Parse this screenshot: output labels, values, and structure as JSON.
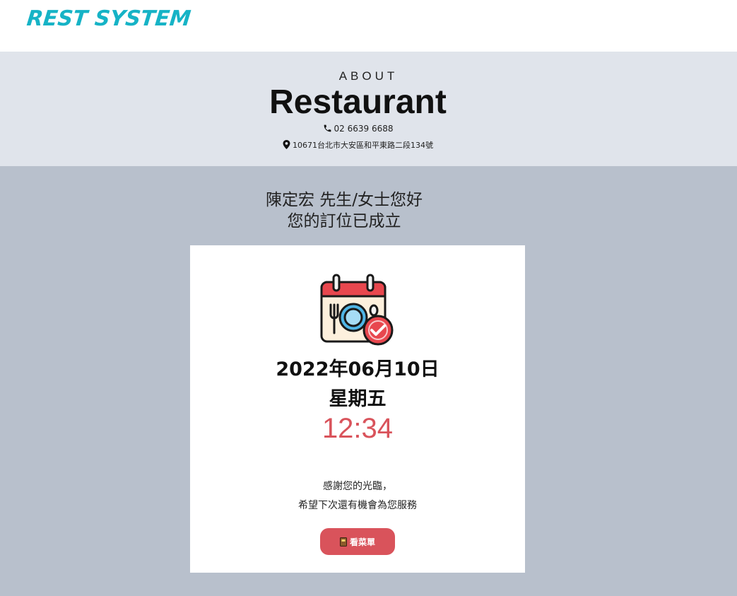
{
  "header": {
    "brand": "REST SYSTEM"
  },
  "hero": {
    "eyebrow": "ABOUT",
    "title": "Restaurant",
    "phone": "02 6639 6688",
    "address": "10671台北市大安區和平東路二段134號"
  },
  "greeting": {
    "line1": "陳定宏 先生/女士您好",
    "line2": "您的訂位已成立"
  },
  "reservation": {
    "date": "2022年06月10日",
    "weekday": "星期五",
    "time": "12:34",
    "thanks_line1": "感謝您的光臨，",
    "thanks_line2": "希望下次還有機會為您服務",
    "menu_button": "看菜單"
  },
  "icons": {
    "calendar": "calendar-dining-check-icon",
    "phone": "phone-icon",
    "location": "map-pin-icon",
    "menu": "menu-book-icon"
  },
  "colors": {
    "brand": "#16b3c6",
    "accent": "#d9535b",
    "hero_bg": "#e0e4eb",
    "page_bg": "#b8c0cc"
  }
}
